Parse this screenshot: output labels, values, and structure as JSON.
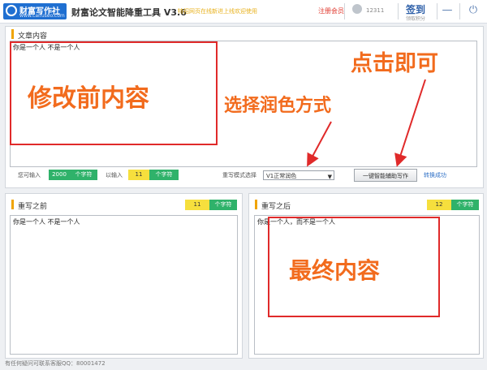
{
  "titlebar": {
    "logo_name": "财富写作社",
    "logo_url": "www.caifuseo.com",
    "app_title": "财富论文智能降重工具 V3.6",
    "marquee": "特招网页在线新进上线欢迎使用",
    "register_link": "注册会员",
    "user_id": "12311",
    "signin_label": "签到",
    "signin_sub": "领取积分",
    "minimize": "—",
    "power": "⏻"
  },
  "article": {
    "title": "文章内容",
    "content": "你是一个人 不是一个人",
    "can_input_label": "您可输入",
    "can_input_value": "2000",
    "unit": "个字符",
    "entered_label": "以输入",
    "entered_value": "11",
    "mode_label": "重写模式选择",
    "mode_value": "V1正常润色",
    "assist_button": "一键智能辅助写作",
    "status": "转换成功"
  },
  "before": {
    "title": "重写之前",
    "count": "11",
    "unit": "个字符",
    "content": "你是一个人 不是一个人"
  },
  "after": {
    "title": "重写之后",
    "count": "12",
    "unit": "个字符",
    "content": "你是一个人，而不是一个人"
  },
  "annotations": {
    "before_content": "修改前内容",
    "choose_style": "选择润色方式",
    "click_go": "点击即可",
    "final_content": "最终内容"
  },
  "footer": {
    "text": "有任何疑问可联系客服QQ：80001472"
  },
  "colors": {
    "accent_orange": "#f0a400",
    "count_green": "#2fb26a",
    "count_yellow": "#f6df3d",
    "annotation_red": "#e02a2a",
    "annotation_orange": "#f26b1d",
    "brand_blue": "#1f6fd1"
  }
}
